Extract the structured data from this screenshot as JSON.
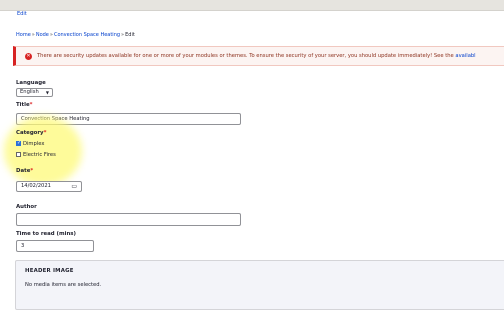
{
  "tabs": {
    "edit": "Edit"
  },
  "breadcrumb": {
    "home": "Home",
    "node": "Node",
    "page": "Convection Space Heating",
    "current": "Edit"
  },
  "alert": {
    "text": "There are security updates available for one or more of your modules or themes. To ensure the security of your server, you should update immediately! See the ",
    "link": "availabl"
  },
  "form": {
    "language": {
      "label": "Language",
      "value": "English"
    },
    "title": {
      "label": "Title",
      "required_mark": "*",
      "value": "Convection Space Heating"
    },
    "category": {
      "label": "Category",
      "required_mark": "*",
      "options": [
        {
          "label": "Dimplex",
          "checked": true
        },
        {
          "label": "Electric Fires",
          "checked": false
        }
      ]
    },
    "date": {
      "label": "Date",
      "required_mark": "*",
      "day": "14",
      "month": "02",
      "year": "2021"
    },
    "author": {
      "label": "Author",
      "value": ""
    },
    "time_to_read": {
      "label": "Time to read (mins)",
      "value": "3"
    },
    "header_image": {
      "title": "HEADER IMAGE",
      "empty_text": "No media items are selected."
    }
  },
  "colors": {
    "link": "#003ecc",
    "error": "#d72222",
    "required": "#dc2323",
    "highlight": "#fdfa78"
  }
}
